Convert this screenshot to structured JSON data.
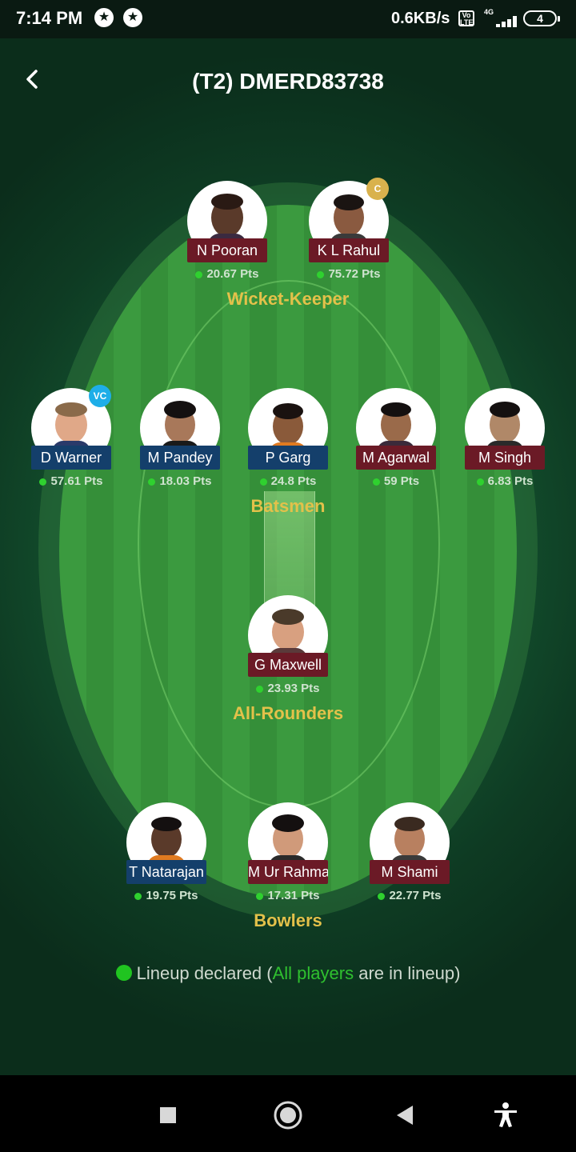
{
  "status_bar": {
    "time": "7:14 PM",
    "icons": [
      "star-badge-icon",
      "star-badge-icon"
    ],
    "network_speed": "0.6KB/s",
    "volte": "Vo LTE",
    "network_type": "4G",
    "battery": "4"
  },
  "header": {
    "title": "(T2) DMERD83738",
    "back_icon": "chevron-left-icon"
  },
  "roles": {
    "wicket_keeper": "Wicket-Keeper",
    "batsmen": "Batsmen",
    "all_rounders": "All-Rounders",
    "bowlers": "Bowlers"
  },
  "players": {
    "wk": [
      {
        "name": "N Pooran",
        "points": "20.67 Pts",
        "team_color": "#6b1a26"
      },
      {
        "name": "K L Rahul",
        "points": "75.72 Pts",
        "team_color": "#6b1a26",
        "badge": "C"
      }
    ],
    "bat": [
      {
        "name": "D Warner",
        "points": "57.61 Pts",
        "team_color": "#143f6b",
        "badge": "VC"
      },
      {
        "name": "M Pandey",
        "points": "18.03 Pts",
        "team_color": "#143f6b"
      },
      {
        "name": "P Garg",
        "points": "24.8 Pts",
        "team_color": "#143f6b"
      },
      {
        "name": "M Agarwal",
        "points": "59 Pts",
        "team_color": "#6b1a26"
      },
      {
        "name": "M Singh",
        "points": "6.83 Pts",
        "team_color": "#6b1a26"
      }
    ],
    "ar": [
      {
        "name": "G Maxwell",
        "points": "23.93 Pts",
        "team_color": "#6b1a26"
      }
    ],
    "bowl": [
      {
        "name": "T Natarajan",
        "points": "19.75 Pts",
        "team_color": "#143f6b"
      },
      {
        "name": "M Ur Rahman",
        "points": "17.31 Pts",
        "team_color": "#6b1a26"
      },
      {
        "name": "M Shami",
        "points": "22.77 Pts",
        "team_color": "#6b1a26"
      }
    ]
  },
  "lineup": {
    "prefix": "Lineup declared (",
    "highlight": "All players",
    "suffix": " are in lineup)"
  },
  "nav_bar": {
    "icons": [
      "square-icon",
      "home-circle-icon",
      "back-triangle-icon",
      "accessibility-icon"
    ]
  },
  "colors": {
    "accent_gold": "#e3c14a",
    "points_dot": "#2fd12f",
    "lineup_green": "#2fc02f"
  }
}
